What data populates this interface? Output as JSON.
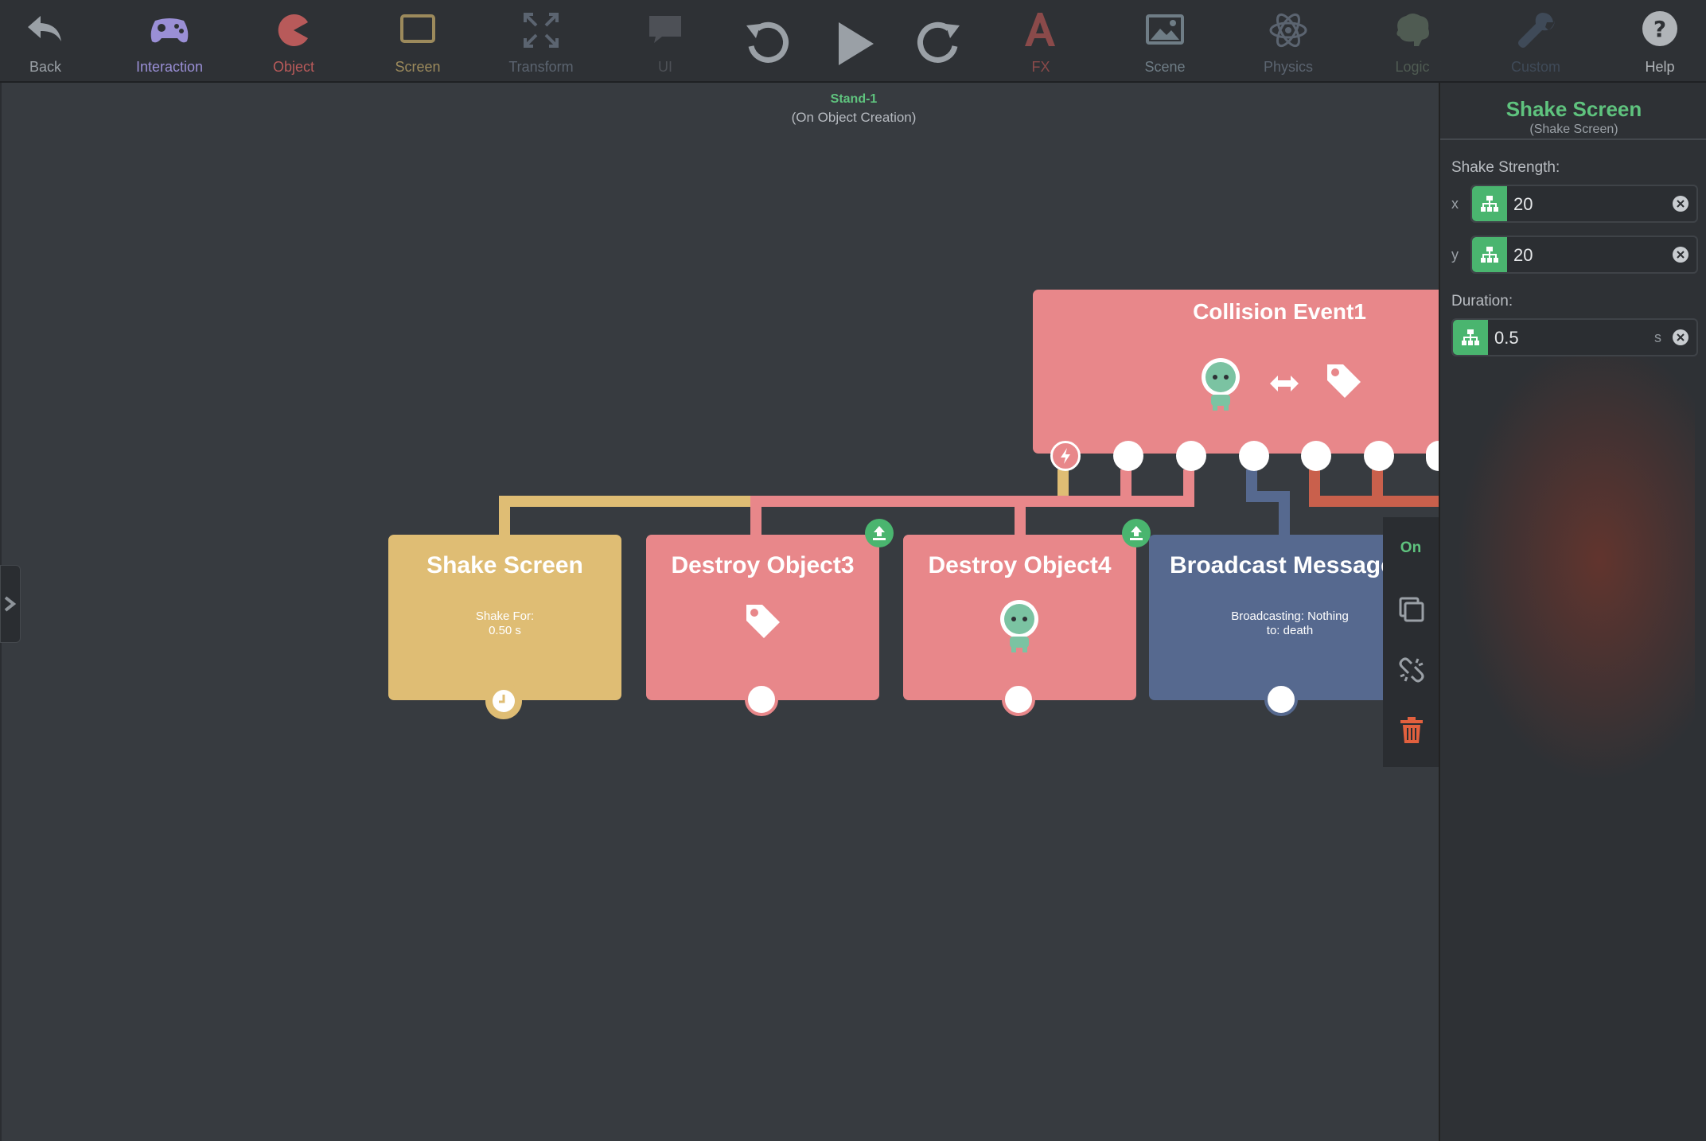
{
  "toolbar": {
    "items": [
      {
        "label": "Back",
        "icon": "back-arrow-icon",
        "color": "#9aa0a6"
      },
      {
        "label": "Interaction",
        "icon": "gamepad-icon",
        "color": "#9a8fd6"
      },
      {
        "label": "Object",
        "icon": "pacman-icon",
        "color": "#b85a5a"
      },
      {
        "label": "Screen",
        "icon": "screen-icon",
        "color": "#9c8a5c"
      },
      {
        "label": "Transform",
        "icon": "transform-icon",
        "color": "#5b6470"
      },
      {
        "label": "UI",
        "icon": "speech-bubble-icon",
        "color": "#4d5056"
      },
      {
        "label": "FX",
        "icon": "fx-icon",
        "color": "#8a4a4a"
      },
      {
        "label": "Scene",
        "icon": "image-icon",
        "color": "#6f7d86"
      },
      {
        "label": "Physics",
        "icon": "atom-icon",
        "color": "#5b6470"
      },
      {
        "label": "Logic",
        "icon": "brain-icon",
        "color": "#4f5b52"
      },
      {
        "label": "Custom",
        "icon": "wrench-icon",
        "color": "#3f4a58"
      },
      {
        "label": "Help",
        "icon": "help-icon",
        "color": "#b0b4b8"
      }
    ],
    "controls": {
      "undo": "undo-icon",
      "play": "play-icon",
      "redo": "redo-icon"
    }
  },
  "stand": {
    "name": "Stand-1",
    "trigger": "(On Object Creation)"
  },
  "nodes": {
    "collision": {
      "title": "Collision Event1",
      "color": "#e8878a"
    },
    "shake": {
      "title": "Shake Screen",
      "desc_line1": "Shake For:",
      "desc_line2": "0.50 s",
      "color": "#dfbd74"
    },
    "destroy3": {
      "title": "Destroy Object3",
      "color": "#e8878a"
    },
    "destroy4": {
      "title": "Destroy Object4",
      "color": "#e8878a"
    },
    "broadcast": {
      "title": "Broadcast Message",
      "desc_line1": "Broadcasting: Nothing",
      "desc_line2": "to: death",
      "color": "#56698f"
    }
  },
  "side_menu": {
    "toggle_label": "On"
  },
  "panel": {
    "title": "Shake Screen",
    "subtitle": "(Shake Screen)",
    "strength_label": "Shake Strength:",
    "x_label": "x",
    "x_value": "20",
    "y_label": "y",
    "y_value": "20",
    "duration_label": "Duration:",
    "duration_value": "0.5",
    "duration_unit": "s"
  },
  "colors": {
    "accent": "#5fc37e",
    "wire_yellow": "#dfbd74",
    "wire_red": "#e8878a",
    "wire_blue": "#56698f",
    "wire_orange": "#c9604c"
  }
}
